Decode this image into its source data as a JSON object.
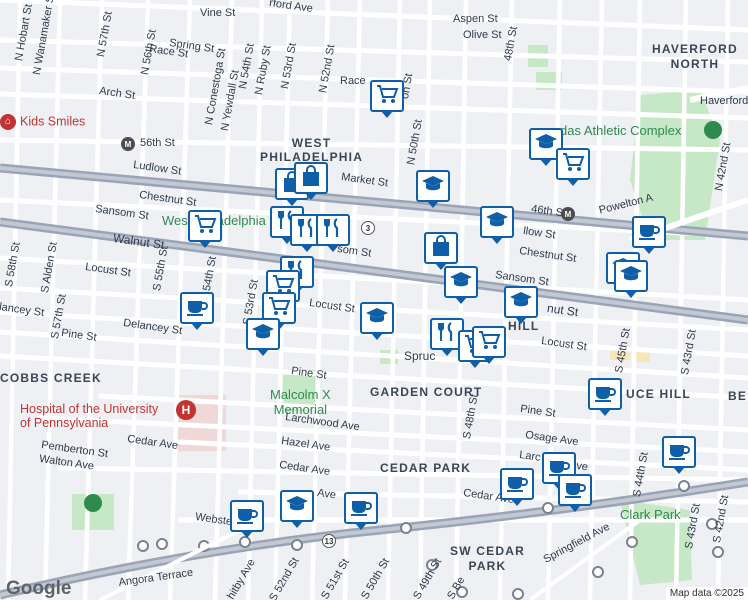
{
  "labels": {
    "vine": "Vine St",
    "haverford_ave_top": "rford Ave",
    "aspen": "Aspen St",
    "olive": "Olive St",
    "haverford_north": "HAVERFORD\nNORTH",
    "haverford_right": "Haverford",
    "n_hobart": "N Hobart St",
    "n_wanamaker": "N Wanamaker St",
    "n_57th": "N 57th St",
    "n_56th": "N 56th St",
    "n_conestoga": "N Conestoga St",
    "n_yewdall": "N Yewdall St",
    "n_54th": "N 54th St",
    "n_ruby": "N Ruby St",
    "n_53rd": "N 53rd St",
    "n_52nd": "N 52nd St",
    "n_50th": "N 50th St",
    "n_48th": "48th St",
    "n_42nd": "N 42nd St",
    "spring": "Spring St",
    "race_left": "Race St",
    "race_mid": "Race",
    "on_st": "on St",
    "arch": "Arch St",
    "kids_smiles": "Kids Smiles",
    "56th_st": "56th St",
    "west_phila": "WEST\nPHILADELPHIA",
    "ludlow_left": "Ludlow St",
    "ludlow_right": "llow St",
    "chestnut_left": "Chestnut St",
    "chestnut_right": "Chestnut St",
    "market": "Market St",
    "46th_st": "46th St",
    "powelton": "Powelton A",
    "sansom_left": "Sansom St",
    "sansom_mid": "som St",
    "sansom_right": "Sansom St",
    "west_phila_green": "West Philadelphia",
    "walnut_left": "Walnut St",
    "walnut_right": "nut St",
    "locust_left": "Locust St",
    "locust_mid": "Locust St",
    "locust_right": "Locust St",
    "lancey": "lancey St",
    "delancey": "Delancey St",
    "pine_left": "Pine St",
    "pine_mid": "Pine St",
    "pine_right": "Pine St",
    "s_58th": "S 58th St",
    "s_alden": "S Alden St",
    "s_57th": "S 57th St",
    "s_55th": "S 55th St",
    "s_54th": "54th St",
    "s_53rd": "S 53rd St",
    "s_48th": "S 48th St",
    "s_45th": "S 45th St",
    "s_44th": "S 44th St",
    "s_43rd": "S 43rd St",
    "s_42nd": "S 42nd St",
    "spruce": "Spruc",
    "hill": "HILL",
    "spruce_hill": "UCE HILL",
    "be": "BE",
    "cobbs_creek": "COBBS CREEK",
    "malcolm_x": "Malcolm X\nMemorial",
    "garden_court": "GARDEN COURT",
    "hospital": "Hospital of the University\nof Pennsylvania",
    "larchwood": "Larchwood Ave",
    "osage": "Osage Ave",
    "hazel": "Hazel Ave",
    "cedar_left": "Cedar Ave",
    "cedar_mid": "Cedar Ave",
    "cedar_right": "Cedar Ave",
    "cedar_park": "CEDAR PARK",
    "pemberton": "Pemberton St",
    "walton": "Walton Ave",
    "larch": "Larc",
    "ave": "Ave",
    "webster": "Webste",
    "clark_park": "Clark Park",
    "springfield": "Springfield Ave",
    "sw_cedar_park": "SW CEDAR\nPARK",
    "angora": "Angora Terrace",
    "whitby": "hitby Ave",
    "s_52nd": "S 52nd St",
    "s_51st": "S 51st St",
    "s_50th": "S 50th St",
    "s_49th": "S 49th St",
    "s_be": "S Be",
    "athletic": "das Athletic Complex",
    "route_3": "3",
    "route_13": "13",
    "metro_m": "M"
  },
  "google_logo": "Google",
  "attribution": "Map data ©2025",
  "colors": {
    "marker_blue": "#0f5ea8",
    "park_green": "#c6e8c6",
    "rail": "#9aa4b4",
    "road": "#ffffff"
  },
  "markers": [
    {
      "type": "cart-icon"
    },
    {
      "type": "graduation-cap-icon"
    },
    {
      "type": "cart-icon"
    },
    {
      "type": "shopping-bag-icon"
    },
    {
      "type": "shopping-bag-icon"
    },
    {
      "type": "graduation-cap-icon"
    },
    {
      "type": "cart-icon"
    },
    {
      "type": "restaurant-icon"
    },
    {
      "type": "restaurant-icon"
    },
    {
      "type": "restaurant-icon"
    },
    {
      "type": "shopping-bag-icon"
    },
    {
      "type": "graduation-cap-icon"
    },
    {
      "type": "coffee-icon"
    },
    {
      "type": "graduation-cap-icon"
    },
    {
      "type": "graduation-cap-icon"
    },
    {
      "type": "restaurant-icon"
    },
    {
      "type": "cart-icon"
    },
    {
      "type": "cart-icon"
    },
    {
      "type": "graduation-cap-icon"
    },
    {
      "type": "graduation-cap-icon"
    },
    {
      "type": "restaurant-icon"
    },
    {
      "type": "cart-icon"
    },
    {
      "type": "cart-icon"
    },
    {
      "type": "coffee-icon"
    },
    {
      "type": "coffee-icon"
    },
    {
      "type": "coffee-icon"
    },
    {
      "type": "coffee-icon"
    },
    {
      "type": "coffee-icon"
    },
    {
      "type": "coffee-icon"
    },
    {
      "type": "graduation-cap-icon"
    },
    {
      "type": "coffee-icon"
    }
  ]
}
